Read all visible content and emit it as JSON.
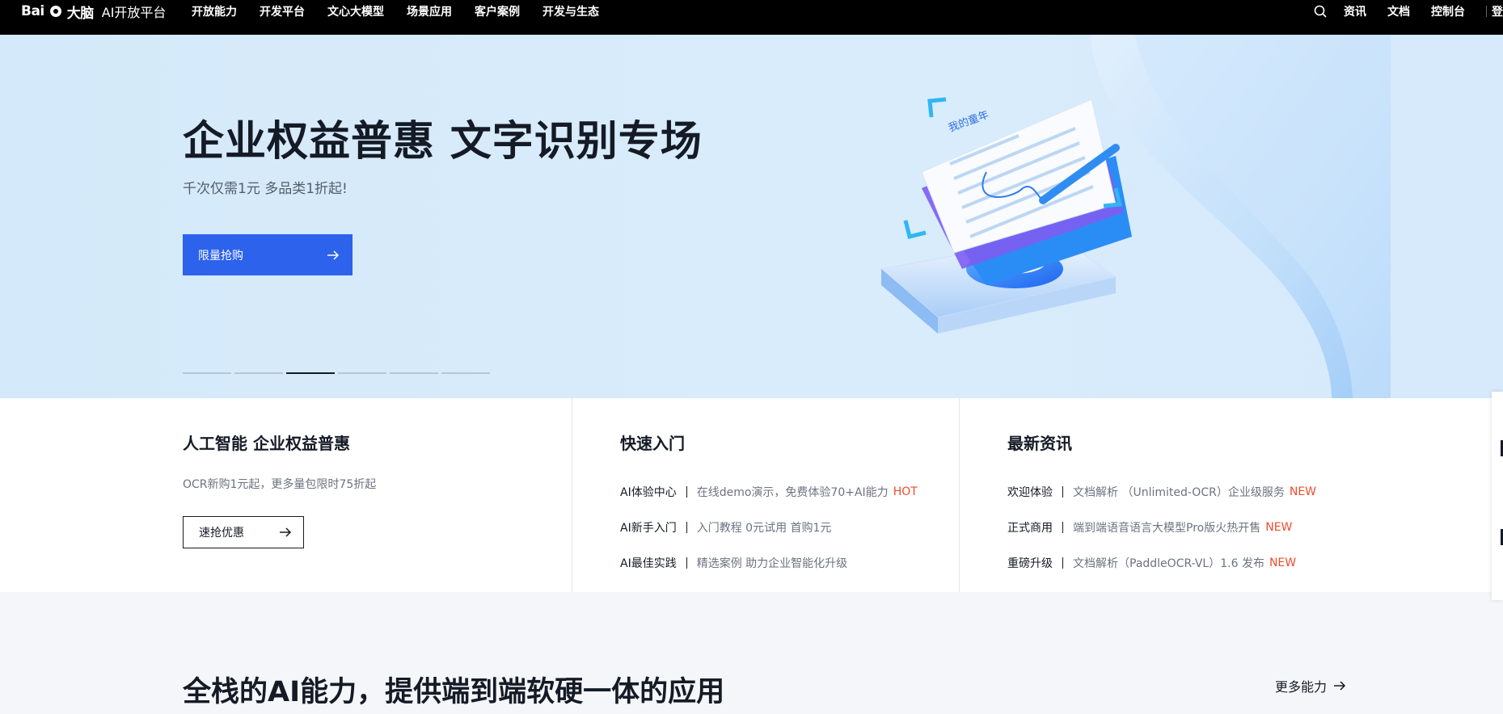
{
  "header": {
    "logo_mark": "Bai",
    "logo_cn": "大脑",
    "logo_sub": "AI开放平台",
    "nav": [
      "开放能力",
      "开发平台",
      "文心大模型",
      "场景应用",
      "客户案例",
      "开发与生态"
    ],
    "right_links": [
      "资讯",
      "文档",
      "控制台"
    ],
    "login": "登"
  },
  "hero": {
    "title": "企业权益普惠 文字识别专场",
    "subtitle": "千次仅需1元 多品类1折起!",
    "cta_label": "限量抢购",
    "illustration_text": "我的童年",
    "carousel_count": 6,
    "carousel_active": 3
  },
  "cards": {
    "promo": {
      "title": "人工智能 企业权益普惠",
      "desc": "OCR新购1元起，更多量包限时75折起",
      "button": "速抢优惠"
    },
    "quickstart": {
      "title": "快速入门",
      "rows": [
        {
          "k": "AI体验中心",
          "v": "在线demo演示，免费体验70+AI能力",
          "tag": "HOT"
        },
        {
          "k": "AI新手入门",
          "v": "入门教程 0元试用 首购1元",
          "tag": ""
        },
        {
          "k": "AI最佳实践",
          "v": "精选案例 助力企业智能化升级",
          "tag": ""
        }
      ]
    },
    "news": {
      "title": "最新资讯",
      "rows": [
        {
          "k": "欢迎体验",
          "v": "文档解析 （Unlimited-OCR）企业级服务",
          "tag": "NEW"
        },
        {
          "k": "正式商用",
          "v": "端到端语音语言大模型Pro版火热开售",
          "tag": "NEW"
        },
        {
          "k": "重磅升级",
          "v": "文档解析（PaddleOCR-VL）1.6 发布",
          "tag": "NEW"
        }
      ]
    }
  },
  "section": {
    "title": "全栈的AI能力，提供端到端软硬一体的应用",
    "more": "更多能力"
  },
  "colors": {
    "primary": "#2d62ed",
    "tag": "#ef4c2c",
    "text": "#151b26",
    "muted": "#6b7380"
  }
}
